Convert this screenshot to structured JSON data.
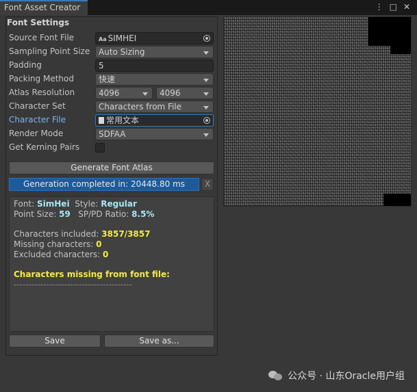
{
  "window": {
    "tab_title": "Font Asset Creator",
    "menu_icon": "kebab-menu-icon",
    "maximize_icon": "maximize-icon",
    "close_icon": "close-icon"
  },
  "settings": {
    "section_title": "Font Settings",
    "source_font_file": {
      "label": "Source Font File",
      "value": "SIMHEI",
      "icon_text": "Aa"
    },
    "sampling_point_size": {
      "label": "Sampling Point Size",
      "value": "Auto Sizing"
    },
    "padding": {
      "label": "Padding",
      "value": "5"
    },
    "packing_method": {
      "label": "Packing Method",
      "value": "快速"
    },
    "atlas_resolution": {
      "label": "Atlas Resolution",
      "width": "4096",
      "height": "4096"
    },
    "character_set": {
      "label": "Character Set",
      "value": "Characters from File"
    },
    "character_file": {
      "label": "Character File",
      "value": "常用文本"
    },
    "render_mode": {
      "label": "Render Mode",
      "value": "SDFAA"
    },
    "get_kerning_pairs": {
      "label": "Get Kerning Pairs",
      "checked": false
    }
  },
  "generate_button": "Generate Font Atlas",
  "progress": {
    "text": "Generation completed in: 20448.80 ms",
    "fraction": 1.0,
    "cancel_label": "X"
  },
  "info": {
    "font_label": "Font:",
    "font_value": "SimHei",
    "style_label": "Style:",
    "style_value": "Regular",
    "point_size_label": "Point Size:",
    "point_size_value": "59",
    "ratio_label": "SP/PD Ratio:",
    "ratio_value": "8.5%",
    "included_label": "Characters included:",
    "included_value": "3857/3857",
    "missing_label": "Missing characters:",
    "missing_value": "0",
    "excluded_label": "Excluded characters:",
    "excluded_value": "0",
    "missing_header": "Characters missing from font file:",
    "separator": "----------------------------------------"
  },
  "save_button": "Save",
  "save_as_button": "Save as...",
  "watermark": "公众号 · 山东Oracle用户组",
  "colors": {
    "accent": "#3a79bb",
    "progress_fill": "#1d5a9c",
    "highlight": "#a7e6f5",
    "warning": "#f6ec3c"
  }
}
